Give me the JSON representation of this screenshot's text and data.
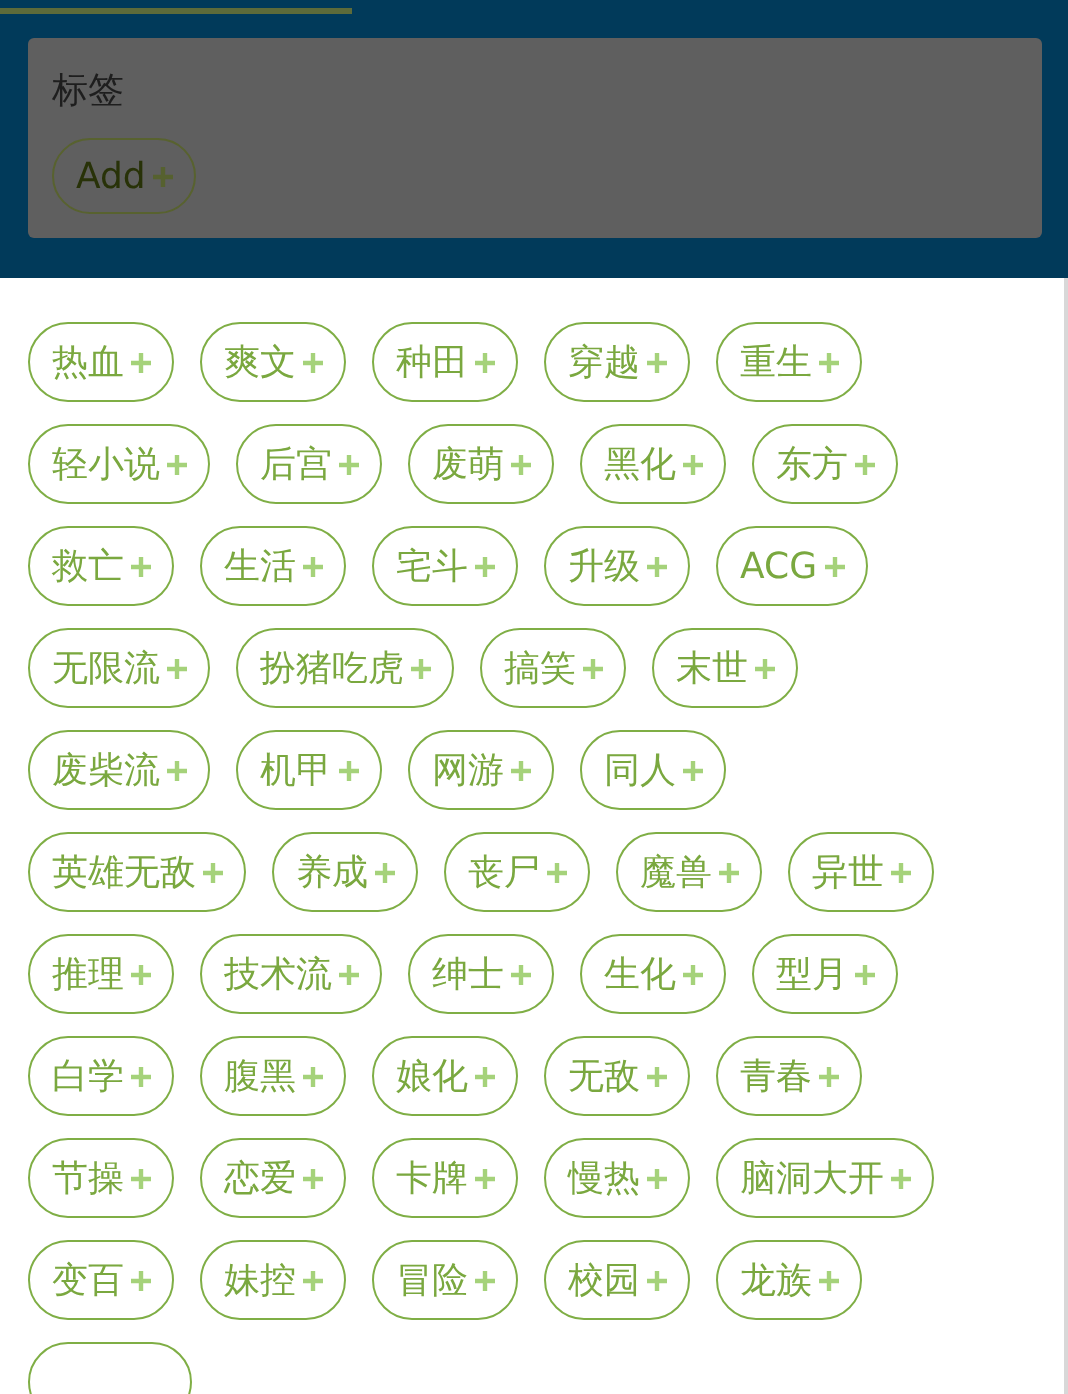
{
  "progress": {
    "level": 0.33
  },
  "card": {
    "title": "标签",
    "add_button": "Add"
  },
  "tag_rows": [
    [
      "热血",
      "爽文",
      "种田",
      "穿越",
      "重生"
    ],
    [
      "轻小说",
      "后宫",
      "废萌",
      "黑化",
      "东方"
    ],
    [
      "救亡",
      "生活",
      "宅斗",
      "升级",
      "ACG"
    ],
    [
      "无限流",
      "扮猪吃虎",
      "搞笑",
      "末世"
    ],
    [
      "废柴流",
      "机甲",
      "网游",
      "同人"
    ],
    [
      "英雄无敌",
      "养成",
      "丧尸",
      "魔兽",
      "异世"
    ],
    [
      "推理",
      "技术流",
      "绅士",
      "生化",
      "型月"
    ],
    [
      "白学",
      "腹黑",
      "娘化",
      "无敌",
      "青春"
    ],
    [
      "节操",
      "恋爱",
      "卡牌",
      "慢热",
      "脑洞大开"
    ],
    [
      "变百",
      "妹控",
      "冒险",
      "校园",
      "龙族"
    ]
  ]
}
